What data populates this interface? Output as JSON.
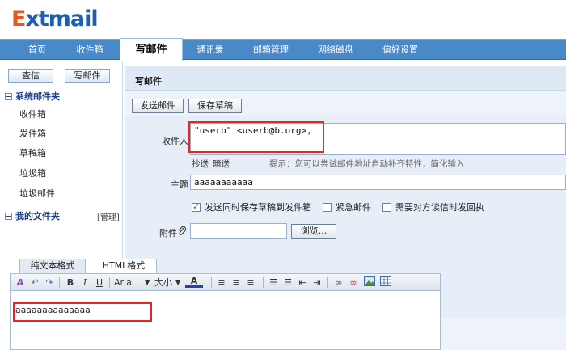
{
  "logo": {
    "prefix": "E",
    "rest": "xtmail"
  },
  "topnav": [
    {
      "label": "首页",
      "active": false
    },
    {
      "label": "收件箱",
      "active": false
    },
    {
      "label": "写邮件",
      "active": true
    },
    {
      "label": "通讯录",
      "active": false
    },
    {
      "label": "邮箱管理",
      "active": false
    },
    {
      "label": "网络磁盘",
      "active": false
    },
    {
      "label": "偏好设置",
      "active": false
    }
  ],
  "sidebar": {
    "query_button": "查信",
    "compose_button": "写邮件",
    "system_folders_label": "系统邮件夹",
    "folders": [
      "收件箱",
      "发件箱",
      "草稿箱",
      "垃圾箱",
      "垃圾邮件"
    ],
    "my_folders_label": "我的文件夹",
    "manage_label": "[管理]"
  },
  "compose": {
    "title": "写邮件",
    "send_button": "发送邮件",
    "save_draft_button": "保存草稿",
    "to_label": "收件人",
    "to_value": "\"userb\" <userb@b.org>,",
    "cc_link": "抄送",
    "bcc_link": "暗送",
    "hint": "提示：您可以尝试邮件地址自动补齐特性，简化输入",
    "subject_label": "主题",
    "subject_value": "aaaaaaaaaaa",
    "options": [
      {
        "label": "发送同时保存草稿到发件箱",
        "checked": true
      },
      {
        "label": "紧急邮件",
        "checked": false
      },
      {
        "label": "需要对方读信时发回执",
        "checked": false
      }
    ],
    "attachment_label": "附件",
    "attachment_value": "",
    "browse_button": "浏览...",
    "editor_tabs": [
      "纯文本格式",
      "HTML格式"
    ],
    "active_editor_tab": "HTML格式",
    "font_name": "Arial",
    "font_size_label": "大小",
    "body_text": "aaaaaaaaaaaaaa"
  },
  "colors": {
    "nav_bg": "#4a89c8",
    "highlight_red": "#e02828",
    "logo_blue": "#1b5fb0",
    "logo_orange": "#e8581e"
  }
}
